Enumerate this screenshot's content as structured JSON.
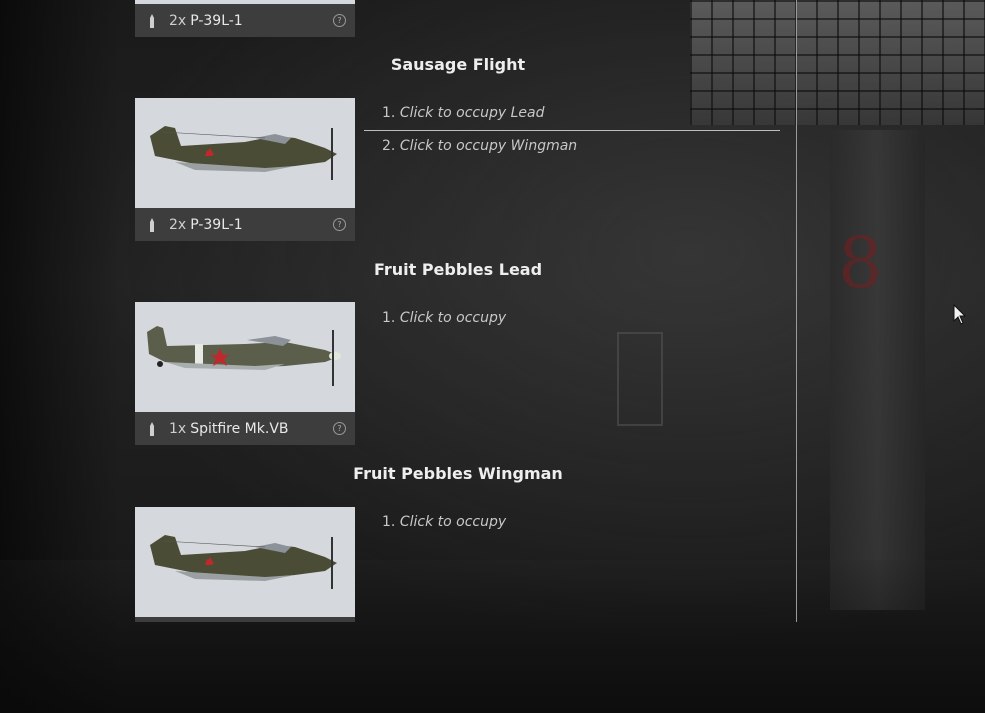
{
  "groups": [
    {
      "title": "",
      "aircraft": {
        "count": "2x",
        "name": "P-39L-1"
      }
    },
    {
      "title": "Sausage Flight",
      "aircraft": {
        "count": "2x",
        "name": "P-39L-1"
      },
      "slots": [
        {
          "num": "1.",
          "label": "Click to occupy Lead"
        },
        {
          "num": "2.",
          "label": "Click to occupy Wingman"
        }
      ]
    },
    {
      "title": "Fruit Pebbles Lead",
      "aircraft": {
        "count": "1x",
        "name": "Spitfire Mk.VB"
      },
      "slots": [
        {
          "num": "1.",
          "label": "Click to occupy"
        }
      ]
    },
    {
      "title": "Fruit Pebbles Wingman",
      "aircraft": {
        "count": "",
        "name": ""
      },
      "slots": [
        {
          "num": "1.",
          "label": "Click to occupy"
        }
      ]
    }
  ],
  "icons": {
    "ammo": "bullet-icon",
    "help": "question-circle-icon",
    "cursor": "mouse-pointer-icon"
  },
  "colors": {
    "card_bar": "#3d3d3d",
    "image_bg": "#d5d8dc",
    "olive_plane": "#4b4c36",
    "red_star": "#c0282c"
  }
}
